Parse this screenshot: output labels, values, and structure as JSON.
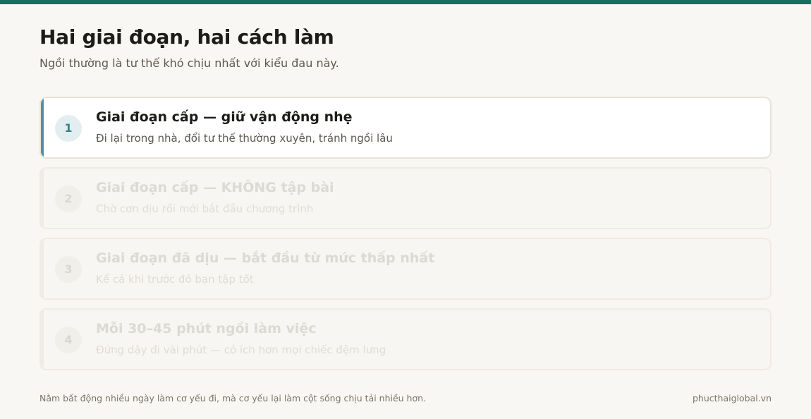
{
  "header": {
    "title": "Hai giai đoạn, hai cách làm",
    "subtitle": "Ngồi thường là tư thế khó chịu nhất với kiểu đau này."
  },
  "steps": [
    {
      "number": "1",
      "title": "Giai đoạn cấp — giữ vận động nhẹ",
      "description": "Đi lại trong nhà, đổi tư thế thường xuyên, tránh ngồi lâu",
      "active": true
    },
    {
      "number": "2",
      "title": "Giai đoạn cấp — KHÔNG tập bài",
      "description": "Chờ cơn dịu rồi mới bắt đầu chương trình",
      "active": false
    },
    {
      "number": "3",
      "title": "Giai đoạn đã dịu — bắt đầu từ mức thấp nhất",
      "description": "Kể cả khi trước đó bạn tập tốt",
      "active": false
    },
    {
      "number": "4",
      "title": "Mỗi 30–45 phút ngồi làm việc",
      "description": "Đứng dậy đi vài phút — có ích hơn mọi chiếc đệm lưng",
      "active": false
    }
  ],
  "footer": {
    "note": "Nằm bất động nhiều ngày làm cơ yếu đi, mà cơ yếu lại làm cột sống chịu tải nhiều hơn.",
    "site": "phucthaiglobal.vn"
  },
  "colors": {
    "accent": "#17705f",
    "step_accent": "#4f94a0"
  }
}
